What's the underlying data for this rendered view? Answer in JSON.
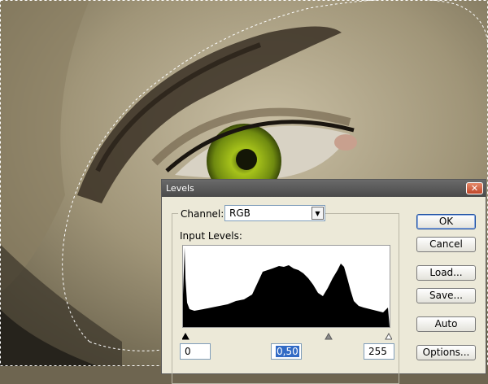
{
  "dialog": {
    "title": "Levels",
    "close_glyph": "✕",
    "channel_label": "Channel:",
    "channel_value": "RGB",
    "input_levels_label": "Input Levels:",
    "input_black": "0",
    "input_gamma": "0,50",
    "input_white": "255"
  },
  "buttons": {
    "ok": "OK",
    "cancel": "Cancel",
    "load": "Load...",
    "save": "Save...",
    "auto": "Auto",
    "options": "Options..."
  },
  "icons": {
    "dropdown": "chevron-down-icon",
    "close": "close-icon"
  }
}
